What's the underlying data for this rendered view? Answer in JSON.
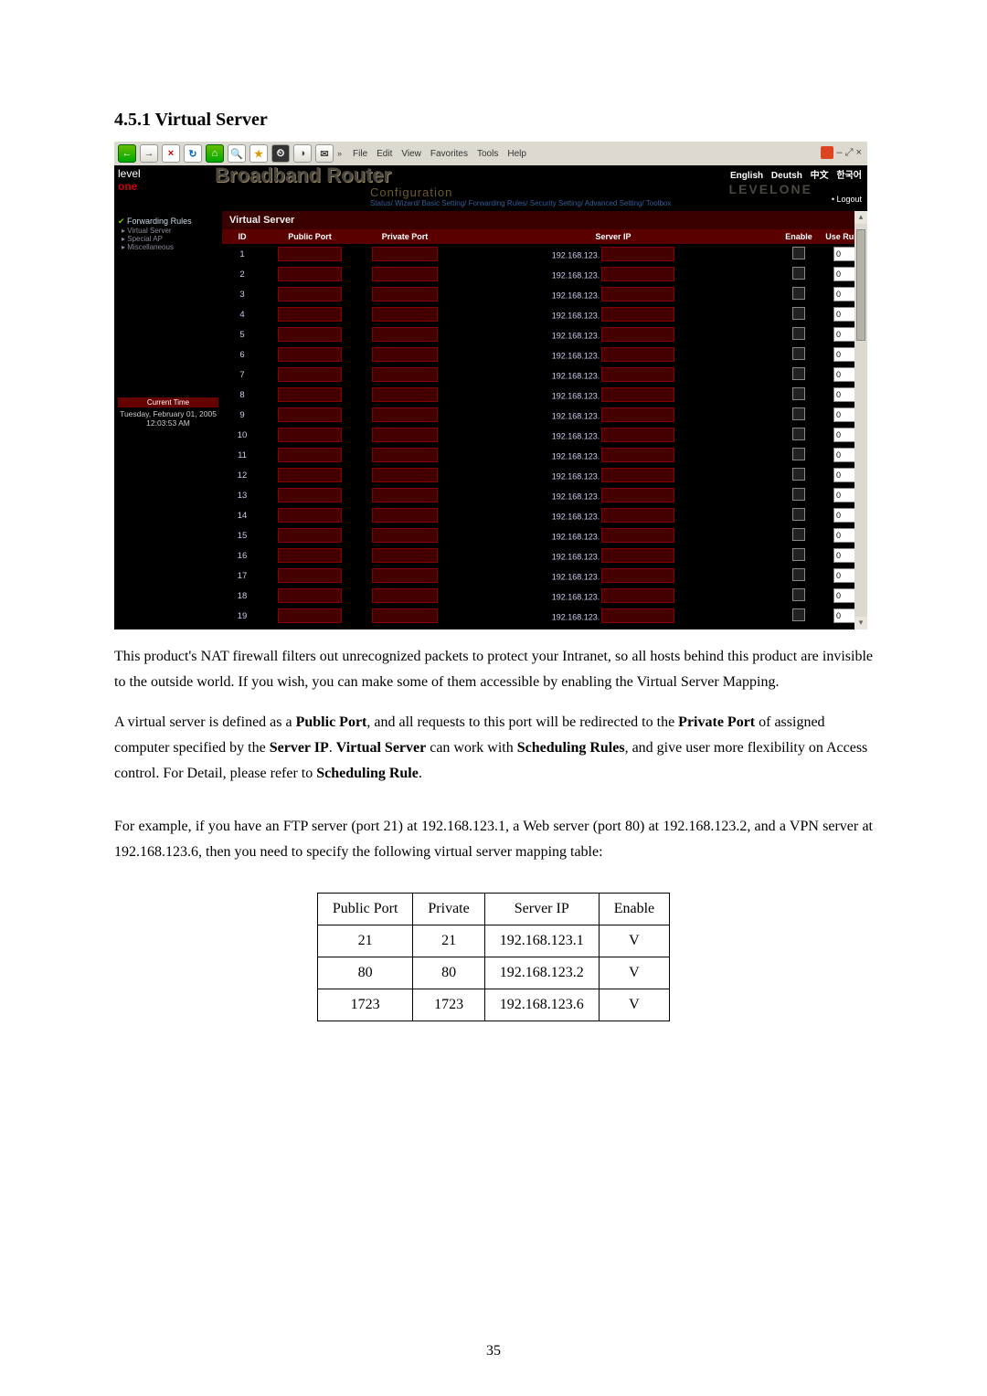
{
  "section_title": "4.5.1 Virtual Server",
  "browser_menu": [
    "File",
    "Edit",
    "View",
    "Favorites",
    "Tools",
    "Help"
  ],
  "win_ctrl": "– ⤢ ×",
  "logo": {
    "line1": "level",
    "line2": "one"
  },
  "banner_title": "Broadband Router",
  "banner_sub": "Configuration",
  "banner_crumbs": "Status/ Wizard/ Basic Setting/ Forwarding Rules/ Security Setting/ Advanced Setting/ Toolbox",
  "brand_right": "LEVELONE",
  "langs": [
    "English",
    "Deutsh",
    "中文",
    "한국어"
  ],
  "logout": "Logout",
  "sidebar": {
    "group": "Forwarding Rules",
    "items": [
      "Virtual Server",
      "Special AP",
      "Miscellaneous"
    ],
    "time_hdr": "Current Time",
    "time_date": "Tuesday, February 01, 2005",
    "time_clock": "12:03:53 AM"
  },
  "panel_title": "Virtual Server",
  "table_headers": [
    "ID",
    "Public Port",
    "Private Port",
    "Server IP",
    "Enable",
    "Use Rule#"
  ],
  "rows": [
    {
      "id": 1,
      "ip": "192.168.123.",
      "rule": "0"
    },
    {
      "id": 2,
      "ip": "192.168.123.",
      "rule": "0"
    },
    {
      "id": 3,
      "ip": "192.168.123.",
      "rule": "0"
    },
    {
      "id": 4,
      "ip": "192.168.123.",
      "rule": "0"
    },
    {
      "id": 5,
      "ip": "192.168.123.",
      "rule": "0"
    },
    {
      "id": 6,
      "ip": "192.168.123.",
      "rule": "0"
    },
    {
      "id": 7,
      "ip": "192.168.123.",
      "rule": "0"
    },
    {
      "id": 8,
      "ip": "192.168.123.",
      "rule": "0"
    },
    {
      "id": 9,
      "ip": "192.168.123.",
      "rule": "0"
    },
    {
      "id": 10,
      "ip": "192.168.123.",
      "rule": "0"
    },
    {
      "id": 11,
      "ip": "192.168.123.",
      "rule": "0"
    },
    {
      "id": 12,
      "ip": "192.168.123.",
      "rule": "0"
    },
    {
      "id": 13,
      "ip": "192.168.123.",
      "rule": "0"
    },
    {
      "id": 14,
      "ip": "192.168.123.",
      "rule": "0"
    },
    {
      "id": 15,
      "ip": "192.168.123.",
      "rule": "0"
    },
    {
      "id": 16,
      "ip": "192.168.123.",
      "rule": "0"
    },
    {
      "id": 17,
      "ip": "192.168.123.",
      "rule": "0"
    },
    {
      "id": 18,
      "ip": "192.168.123.",
      "rule": "0"
    },
    {
      "id": 19,
      "ip": "192.168.123.",
      "rule": "0"
    }
  ],
  "doc_para1": "This product's NAT firewall filters out unrecognized packets to protect your Intranet, so all hosts behind this product are invisible to the outside world. If you wish, you can make some of them accessible by enabling the Virtual Server Mapping.",
  "doc_para2_a": "A virtual server is defined as a ",
  "doc_para2_b": "Public Port",
  "doc_para2_c": ", and all requests to this port will be redirected to the ",
  "doc_para2_d": "Private Port",
  "doc_para2_e": " of assigned computer specified by the ",
  "doc_para2_f": "Server IP",
  "doc_para2_g": ".   ",
  "doc_para2_h": "Virtual Server",
  "doc_para2_i": " can work with ",
  "doc_para2_j": "Scheduling Rules",
  "doc_para2_k": ", and give user more flexibility on Access control. For Detail, please refer to ",
  "doc_para2_l": "Scheduling Rule",
  "doc_para2_m": ".",
  "doc_para3": "For example, if you have an FTP server (port 21) at 192.168.123.1, a Web server (port 80) at 192.168.123.2, and a VPN server at 192.168.123.6, then you need to specify the following virtual server mapping table:",
  "ex_headers": [
    "Public Port",
    "Private",
    "Server IP",
    "Enable"
  ],
  "ex_rows": [
    [
      "21",
      "21",
      "192.168.123.1",
      "V"
    ],
    [
      "80",
      "80",
      "192.168.123.2",
      "V"
    ],
    [
      "1723",
      "1723",
      "192.168.123.6",
      "V"
    ]
  ],
  "page_no": "35"
}
